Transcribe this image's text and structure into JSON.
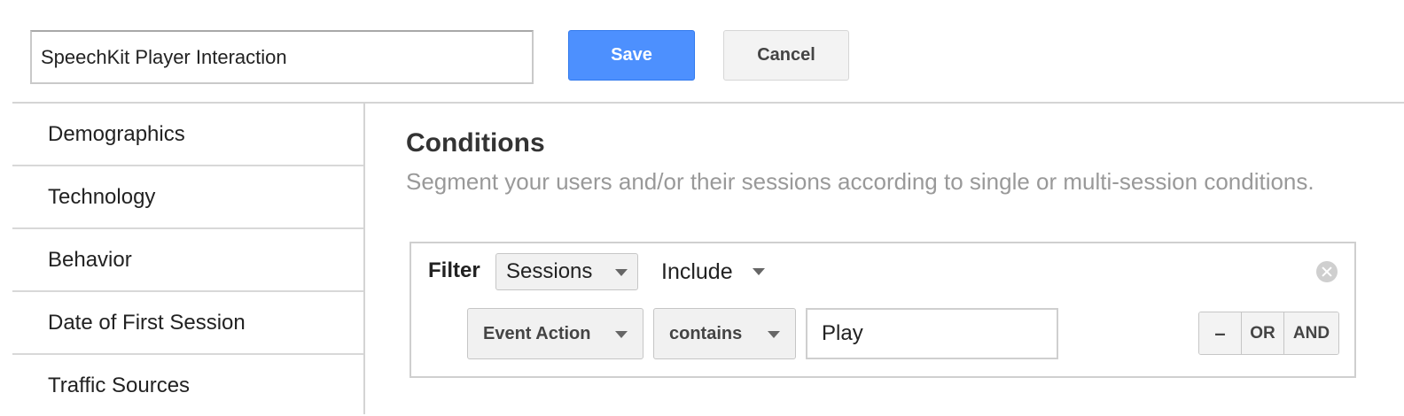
{
  "header": {
    "segment_name": "SpeechKit Player Interaction",
    "save_label": "Save",
    "cancel_label": "Cancel"
  },
  "sidebar": {
    "items": [
      {
        "label": "Demographics"
      },
      {
        "label": "Technology"
      },
      {
        "label": "Behavior"
      },
      {
        "label": "Date of First Session"
      },
      {
        "label": "Traffic Sources"
      }
    ]
  },
  "conditions": {
    "title": "Conditions",
    "subtitle": "Segment your users and/or their sessions according to single or multi-session conditions.",
    "filter": {
      "label": "Filter",
      "scope": "Sessions",
      "mode": "Include",
      "row": {
        "dimension": "Event Action",
        "operator": "contains",
        "value": "Play",
        "remove_label": "–",
        "or_label": "OR",
        "and_label": "AND"
      }
    }
  },
  "colors": {
    "primary_button": "#4d90fe",
    "secondary_button": "#f3f3f3",
    "subtitle_text": "#999999"
  },
  "icons": {
    "dropdown": "chevron-down-icon",
    "clear": "close-circle-icon"
  }
}
